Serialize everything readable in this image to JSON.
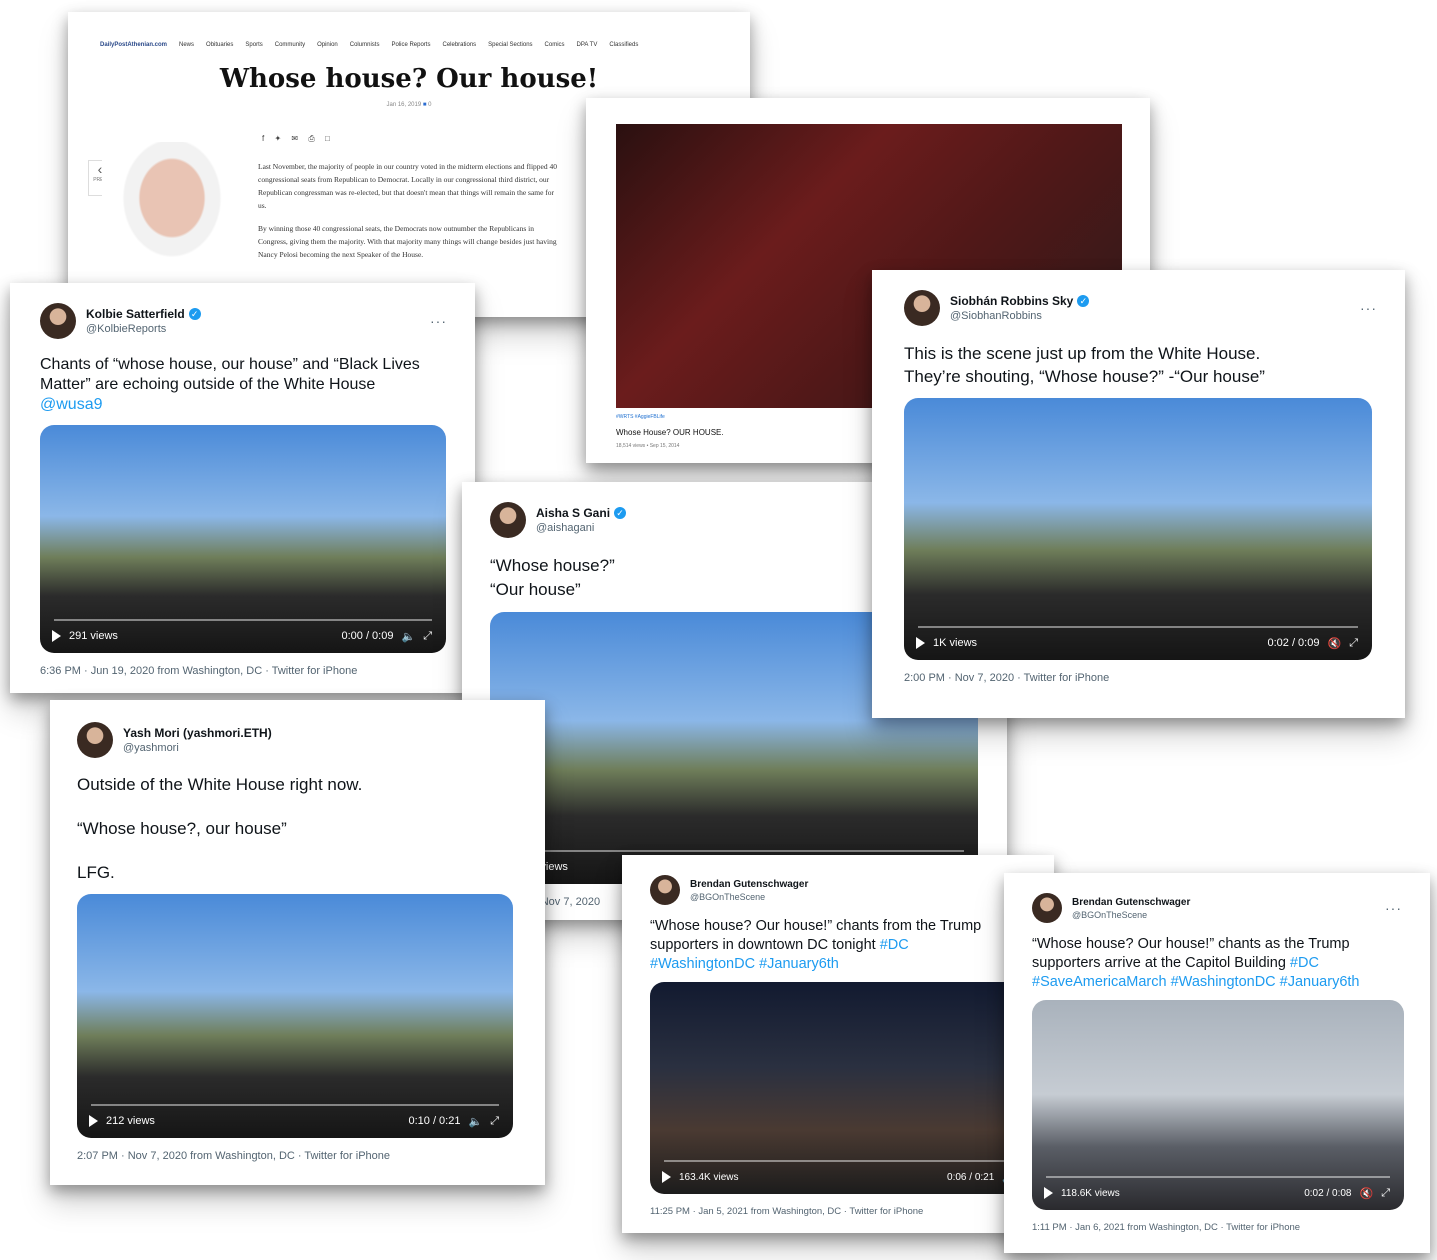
{
  "article": {
    "nav": [
      "DailyPostAthenian.com",
      "News",
      "Obituaries",
      "Sports",
      "Community",
      "Opinion",
      "Columnists",
      "Police Reports",
      "Celebrations",
      "Special Sections",
      "Comics",
      "DPA TV",
      "Classifieds"
    ],
    "title": "Whose house? Our house!",
    "date": "Jan 16, 2019",
    "comments": "0",
    "prev_label": "PREV",
    "paragraphs": [
      "Last November, the majority of people in our country voted in the midterm elections and flipped 40 congressional seats from Republican to Democrat. Locally in our congressional third district, our Republican congressman was re-elected, but that doesn't mean that things will remain the same for us.",
      "By winning those 40 congressional seats, the Democrats now outnumber the Republicans in Congress, giving them the majority. With that majority many things will change besides just having Nancy Pelosi becoming the next Speaker of the House."
    ]
  },
  "youtube": {
    "tags": "#WRTS #AggieFBLife",
    "caption": "Whose House? OUR HOUSE.",
    "views": "18,514 views • Sep 15, 2014"
  },
  "tweets": {
    "kolbie": {
      "name": "Kolbie Satterfield",
      "handle": "@KolbieReports",
      "text_lines": [
        "Chants of “whose house, our house” and “Black Lives",
        "Matter” are echoing outside of the White House"
      ],
      "mention": "@wusa9",
      "views": "291 views",
      "time": "0:00 / 0:09",
      "meta": "6:36 PM · Jun 19, 2020 from Washington, DC · Twitter for iPhone"
    },
    "siobhan": {
      "name": "Siobhán Robbins Sky",
      "handle": "@SiobhanRobbins",
      "text_lines": [
        "This is the scene just up from the White House.",
        "They’re shouting, “Whose house?” -“Our house”"
      ],
      "views": "1K views",
      "time": "0:02 / 0:09",
      "meta": "2:00 PM · Nov 7, 2020 · Twitter for iPhone"
    },
    "aisha": {
      "name": "Aisha S Gani",
      "handle": "@aishagani",
      "text_lines": [
        "“Whose house?”",
        "“Our house”"
      ],
      "views": "604 views",
      "meta": "3:57 PM · Nov 7, 2020"
    },
    "yash": {
      "name": "Yash Mori (yashmori.ETH)",
      "handle": "@yashmori",
      "line1": "Outside of the White House right now.",
      "line2": "“Whose house?, our house”",
      "line3": "LFG.",
      "views": "212 views",
      "time": "0:10 / 0:21",
      "meta": "2:07 PM · Nov 7, 2020 from Washington, DC · Twitter for iPhone"
    },
    "brendan1": {
      "name": "Brendan Gutenschwager",
      "handle": "@BGOnTheScene",
      "text_lines": [
        "“Whose house? Our house!” chants from the Trump",
        "supporters in downtown DC tonight"
      ],
      "tag_inline": "#DC",
      "tags_line": "#WashingtonDC #January6th",
      "views": "163.4K views",
      "time": "0:06 / 0:21",
      "meta": "11:25 PM · Jan 5, 2021 from Washington, DC · Twitter for iPhone"
    },
    "brendan2": {
      "name": "Brendan Gutenschwager",
      "handle": "@BGOnTheScene",
      "text_lines": [
        "“Whose house? Our house!” chants as the Trump",
        "supporters arrive at the Capitol Building"
      ],
      "tag_inline": "#DC",
      "tags_line": "#SaveAmericaMarch #WashingtonDC #January6th",
      "views": "118.6K views",
      "time": "0:02 / 0:08",
      "meta": "1:11 PM · Jan 6, 2021 from Washington, DC · Twitter for iPhone"
    }
  },
  "icons": {
    "verified": "verified-badge-icon",
    "more": "more-icon",
    "play": "play-icon",
    "mute": "mute-icon",
    "expand": "expand-icon"
  },
  "colors": {
    "link": "#1d9bf0",
    "verified": "#1d9bf0",
    "secondary_text": "#536471"
  }
}
